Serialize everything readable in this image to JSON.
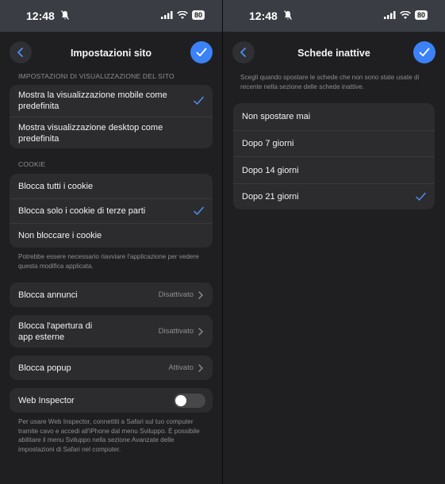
{
  "status": {
    "time": "12:48",
    "battery": "80"
  },
  "left": {
    "title": "Impostazioni sito",
    "display_header": "IMPOSTAZIONI DI VISUALIZZAZIONE DEL SITO",
    "display_options": [
      {
        "label_line1": "Mostra la visualizzazione mobile come",
        "label_line2": "predefinita",
        "selected": true
      },
      {
        "label_line1": "Mostra visualizzazione desktop come",
        "label_line2": "predefinita",
        "selected": false
      }
    ],
    "cookie_header": "COOKIE",
    "cookie_options": [
      {
        "label": "Blocca tutti i cookie",
        "selected": false
      },
      {
        "label": "Blocca solo i cookie di terze parti",
        "selected": true
      },
      {
        "label": "Non bloccare i cookie",
        "selected": false
      }
    ],
    "cookie_note": "Potrebbe essere necessario riavviare l'applicazione per vedere questa modifica applicata.",
    "ads": {
      "label": "Blocca annunci",
      "value": "Disattivato"
    },
    "external_apps": {
      "label_line1": "Blocca l'apertura di",
      "label_line2": "app esterne",
      "value": "Disattivato"
    },
    "popup": {
      "label": "Blocca popup",
      "value": "Attivato"
    },
    "web_inspector": {
      "label": "Web Inspector",
      "enabled": false
    },
    "inspector_note": "Per usare Web Inspector, connettiti a Safari sul tuo computer tramite cavo e accedi all'iPhone dal menu Sviluppo. È possibile abilitare il menu Sviluppo nella sezione Avanzate delle impostazioni di Safari nel computer."
  },
  "right": {
    "title": "Schede inattive",
    "description": "Scegli quando spostare le schede che non sono state usate di recente nella sezione delle schede inattive.",
    "options": [
      {
        "label": "Non spostare mai",
        "selected": false
      },
      {
        "label": "Dopo 7 giorni",
        "selected": false
      },
      {
        "label": "Dopo 14 giorni",
        "selected": false
      },
      {
        "label": "Dopo 21 giorni",
        "selected": true
      }
    ]
  },
  "colors": {
    "accent": "#3b82f6",
    "background": "#1f1f21",
    "cell": "#2c2c2e",
    "secondary_text": "#8e8e93"
  }
}
